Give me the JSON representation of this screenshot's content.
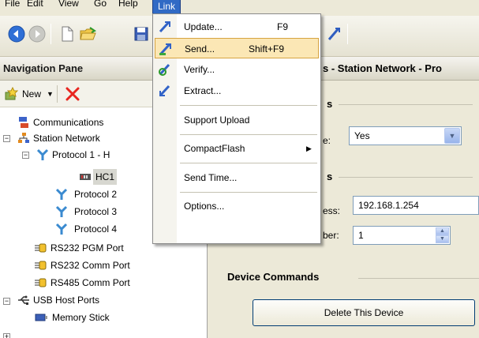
{
  "menubar": {
    "items": [
      "File",
      "Edit",
      "View",
      "Go",
      "Link",
      "Help"
    ],
    "active_index": 4
  },
  "toolbar": {
    "icons": [
      "back-icon",
      "forward-icon",
      "new-document-icon",
      "open-folder-icon",
      "save-icon",
      "link-arrow-icon"
    ]
  },
  "nav": {
    "title": "Navigation Pane",
    "new_label": "New",
    "tree": [
      {
        "label": "Communications",
        "icon": "communications-icon"
      },
      {
        "label": "Station Network",
        "icon": "network-icon",
        "expander": "−"
      },
      {
        "label": "Protocol 1 - H",
        "icon": "protocol-icon",
        "expander": "−"
      },
      {
        "label": "HC1",
        "icon": "device-icon",
        "selected": true
      },
      {
        "label": "Protocol 2",
        "icon": "protocol-icon"
      },
      {
        "label": "Protocol 3",
        "icon": "protocol-icon"
      },
      {
        "label": "Protocol 4",
        "icon": "protocol-icon"
      },
      {
        "label": "RS232 PGM Port",
        "icon": "serial-port-icon"
      },
      {
        "label": "RS232 Comm Port",
        "icon": "serial-port-icon"
      },
      {
        "label": "RS485 Comm Port",
        "icon": "serial-port-icon"
      },
      {
        "label": "USB Host Ports",
        "icon": "usb-icon",
        "expander": "−"
      },
      {
        "label": "Memory Stick",
        "icon": "memory-stick-icon"
      }
    ]
  },
  "right": {
    "header": "s - Station Network - Pro",
    "section1_fragment": "s",
    "row1_label": "e:",
    "row1_value": "Yes",
    "section2_fragment": "s",
    "row2_label": "ess:",
    "row2_value": "192.168.1.254",
    "row3_label": "ber:",
    "row3_value": "1",
    "device_commands_title": "Device Commands",
    "delete_button": "Delete This Device"
  },
  "link_menu": {
    "items": [
      {
        "label": "Update...",
        "shortcut": "F9",
        "icon": "update-icon"
      },
      {
        "label": "Send...",
        "shortcut": "Shift+F9",
        "icon": "send-icon",
        "highlighted": true
      },
      {
        "label": "Verify...",
        "shortcut": "",
        "icon": "verify-icon"
      },
      {
        "label": "Extract...",
        "shortcut": "",
        "icon": "extract-icon"
      },
      {
        "label": "Support Upload",
        "shortcut": ""
      },
      {
        "label": "CompactFlash",
        "shortcut": "",
        "submenu": true
      },
      {
        "label": "Send Time...",
        "shortcut": ""
      },
      {
        "label": "Options...",
        "shortcut": ""
      }
    ]
  },
  "colors": {
    "menu_highlight": "#fbe7b5",
    "menu_highlight_border": "#d6a341",
    "active_menu": "#316ac5",
    "delete_x": "#e8261f"
  }
}
